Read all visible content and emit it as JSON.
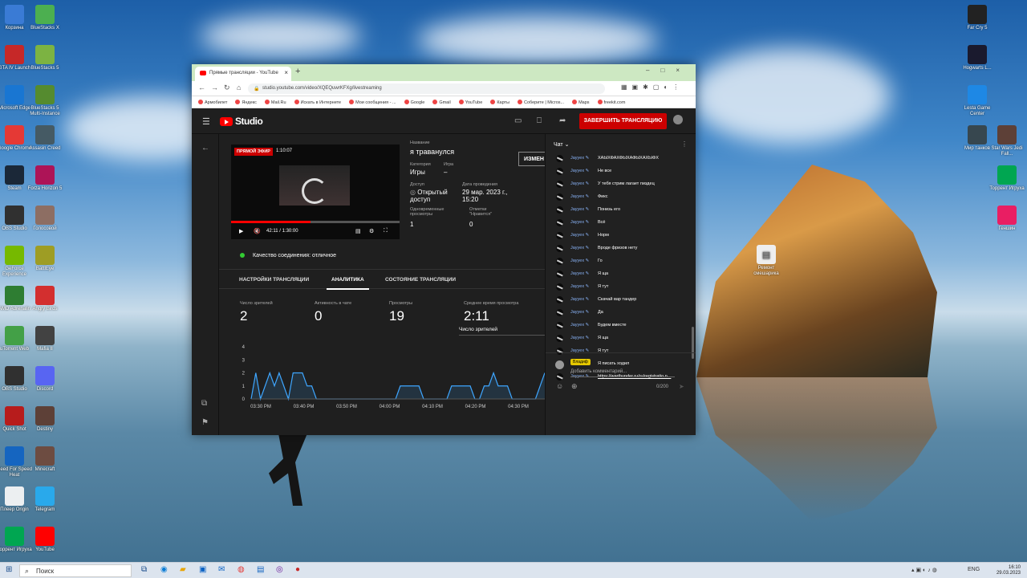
{
  "desktop": {
    "left_icons": [
      {
        "label": "Корзина",
        "color": "#3a7bd5"
      },
      {
        "label": "BlueStacks X",
        "color": "#4caf50"
      },
      {
        "label": "GTA IV Launch",
        "color": "#c62828"
      },
      {
        "label": "BlueStacks 5",
        "color": "#7cb342"
      },
      {
        "label": "Microsoft Edge",
        "color": "#1976d2"
      },
      {
        "label": "BlueStacks 5 Multi-Instance",
        "color": "#558b2f"
      },
      {
        "label": "Google Chrome",
        "color": "#e53935"
      },
      {
        "label": "Assasin Creed",
        "color": "#455a64"
      },
      {
        "label": "Steam",
        "color": "#1b2838"
      },
      {
        "label": "Forza Horizon 5",
        "color": "#ad1457"
      },
      {
        "label": "OBS Studio",
        "color": "#303030"
      },
      {
        "label": "Голосовой",
        "color": "#8d6e63"
      },
      {
        "label": "GeForce Experience",
        "color": "#76b900"
      },
      {
        "label": "BattlEye",
        "color": "#9e9d24"
      },
      {
        "label": "AMD Adrenalin",
        "color": "#2e7d32"
      },
      {
        "label": "Angry Birds",
        "color": "#d32f2f"
      },
      {
        "label": "uTorrent Web",
        "color": "#43a047"
      },
      {
        "label": "Mafia II",
        "color": "#424242"
      },
      {
        "label": "OBS Studio",
        "color": "#303030"
      },
      {
        "label": "Discord",
        "color": "#5865f2"
      },
      {
        "label": "Quick Shot",
        "color": "#b71c1c"
      },
      {
        "label": "Destiny",
        "color": "#5d4037"
      },
      {
        "label": "Need For Speed Heat",
        "color": "#1565c0"
      },
      {
        "label": "Minecraft",
        "color": "#6d4c41"
      },
      {
        "label": "Плеер Origin",
        "color": "#eceff1"
      },
      {
        "label": "Telegram",
        "color": "#29a9eb"
      },
      {
        "label": "Торрент Игруха",
        "color": "#00a651"
      },
      {
        "label": "YouTube",
        "color": "#ff0000"
      }
    ],
    "right_icons": [
      {
        "label": "Far Cry 5",
        "color": "#222222"
      },
      {
        "label": "Hogwarts L...",
        "color": "#1a1a2e"
      },
      {
        "label": "Lesta Game Center",
        "color": "#1e88e5"
      },
      {
        "label": "Мир танков",
        "color": "#37474f"
      },
      {
        "label": "Star Wars Jedi Fall...",
        "color": "#5d4037"
      },
      {
        "label": "Торрент Игруха",
        "color": "#00a651"
      },
      {
        "label": "Геншин",
        "color": "#e91e63"
      }
    ],
    "file_icon": {
      "label": "Ремонт смешарика"
    }
  },
  "browser": {
    "tab_title": "Прямые трансляции - YouTube",
    "url": "studio.youtube.com/video/XQEQuwrKFXg/livestreaming",
    "bookmarks": [
      "Армобилет",
      "Яндекс",
      "Mail.Ru",
      "Искать в Интернете",
      "Мои сообщения - ...",
      "Google",
      "Gmail",
      "YouTube",
      "Карты",
      "Соберите | Micros...",
      "Maps",
      "freekit.com"
    ]
  },
  "studio": {
    "brand": "Studio",
    "end_stream": "ЗАВЕРШИТЬ ТРАНСЛЯЦИЮ",
    "player": {
      "live_badge": "ПРЯМОЙ ЭФИР",
      "live_time": "1:10:07",
      "time": "42:11 / 1:30:00",
      "progress": 0.47
    },
    "info": {
      "title_label": "Название",
      "title": "я траванулся",
      "category_label": "Категория",
      "category": "Игры",
      "game_label": "Игра",
      "game": "–",
      "access_label": "Доступ",
      "access": "Открытый доступ",
      "date_label": "Дата проведения",
      "date": "29 мар. 2023 г., 15:20",
      "concurrent_label": "Одновременные просмотры",
      "concurrent": "1",
      "likes_label": "Отметки \"Нравится\"",
      "likes": "0",
      "change_btn": "ИЗМЕН"
    },
    "quality": "Качество соединения: отличное",
    "tabs": [
      "НАСТРОЙКИ ТРАНСЛЯЦИИ",
      "АНАЛИТИКА",
      "СОСТОЯНИЕ ТРАНСЛЯЦИИ"
    ],
    "metrics": [
      {
        "label": "Число зрителей",
        "value": "2"
      },
      {
        "label": "Активность в чате",
        "value": "0"
      },
      {
        "label": "Просмотры",
        "value": "19"
      },
      {
        "label": "Среднее время просмотра",
        "value": "2:11"
      }
    ],
    "viewers_label": "Число зрителей"
  },
  "chart_data": {
    "type": "area",
    "title": "",
    "xlabel": "",
    "ylabel": "",
    "ylim": [
      0,
      4
    ],
    "yticks": [
      "0",
      "1",
      "2",
      "3",
      "4"
    ],
    "xticks": [
      "03:30 PM",
      "03:40 PM",
      "03:50 PM",
      "04:00 PM",
      "04:10 PM",
      "04:20 PM",
      "04:30 PM"
    ],
    "series": [
      {
        "values": [
          0,
          2,
          0,
          1,
          2,
          1,
          2,
          1,
          0,
          2,
          2,
          2,
          1,
          1,
          0,
          0,
          0,
          0,
          0,
          0,
          0,
          0,
          0,
          0,
          0,
          0,
          0,
          0,
          0,
          0,
          0,
          0,
          1,
          1,
          1,
          1,
          1,
          0,
          0,
          0,
          0,
          0,
          0,
          1,
          1,
          1,
          1,
          1,
          0,
          0,
          1,
          1,
          2,
          1,
          1,
          1,
          0,
          0,
          0,
          0,
          0,
          0,
          1,
          2
        ]
      }
    ],
    "color": "#3ea6ff"
  },
  "chat": {
    "title": "Чат",
    "messages": [
      {
        "user": "Jayyex",
        "text": "ХАЫХФАХФЫХАФЫХАХЫФХ"
      },
      {
        "user": "Jayyex",
        "text": "Не все"
      },
      {
        "user": "Jayyex",
        "text": "У тебя стрим лагает пиздец"
      },
      {
        "user": "Jayyex",
        "text": "Фикс"
      },
      {
        "user": "Jayyex",
        "text": "Понизь его"
      },
      {
        "user": "Jayyex",
        "text": "Всё"
      },
      {
        "user": "Jayyex",
        "text": "Норм"
      },
      {
        "user": "Jayyex",
        "text": "Вроде фризов нету"
      },
      {
        "user": "Jayyex",
        "text": "Го"
      },
      {
        "user": "Jayyex",
        "text": "Я ща"
      },
      {
        "user": "Jayyex",
        "text": "Я тут"
      },
      {
        "user": "Jayyex",
        "text": "Скачай вар тандер"
      },
      {
        "user": "Jayyex",
        "text": "Да"
      },
      {
        "user": "Jayyex",
        "text": "Будем вместе"
      },
      {
        "user": "Jayyex",
        "text": "Я ща"
      },
      {
        "user": "Jayyex",
        "text": "Я тут"
      },
      {
        "user": "Jayyex",
        "text": "Я писать ходил"
      },
      {
        "user": "Jayyex",
        "text": "https://warthunder.ru/ru/registratio n...",
        "link": true
      }
    ],
    "composer": {
      "name": "Владиф",
      "placeholder": "Добавить комментарий...",
      "counter": "0/200"
    }
  },
  "taskbar": {
    "search": "Поиск",
    "time": "16:10",
    "date": "29.03.2023",
    "lang": "ENG"
  }
}
